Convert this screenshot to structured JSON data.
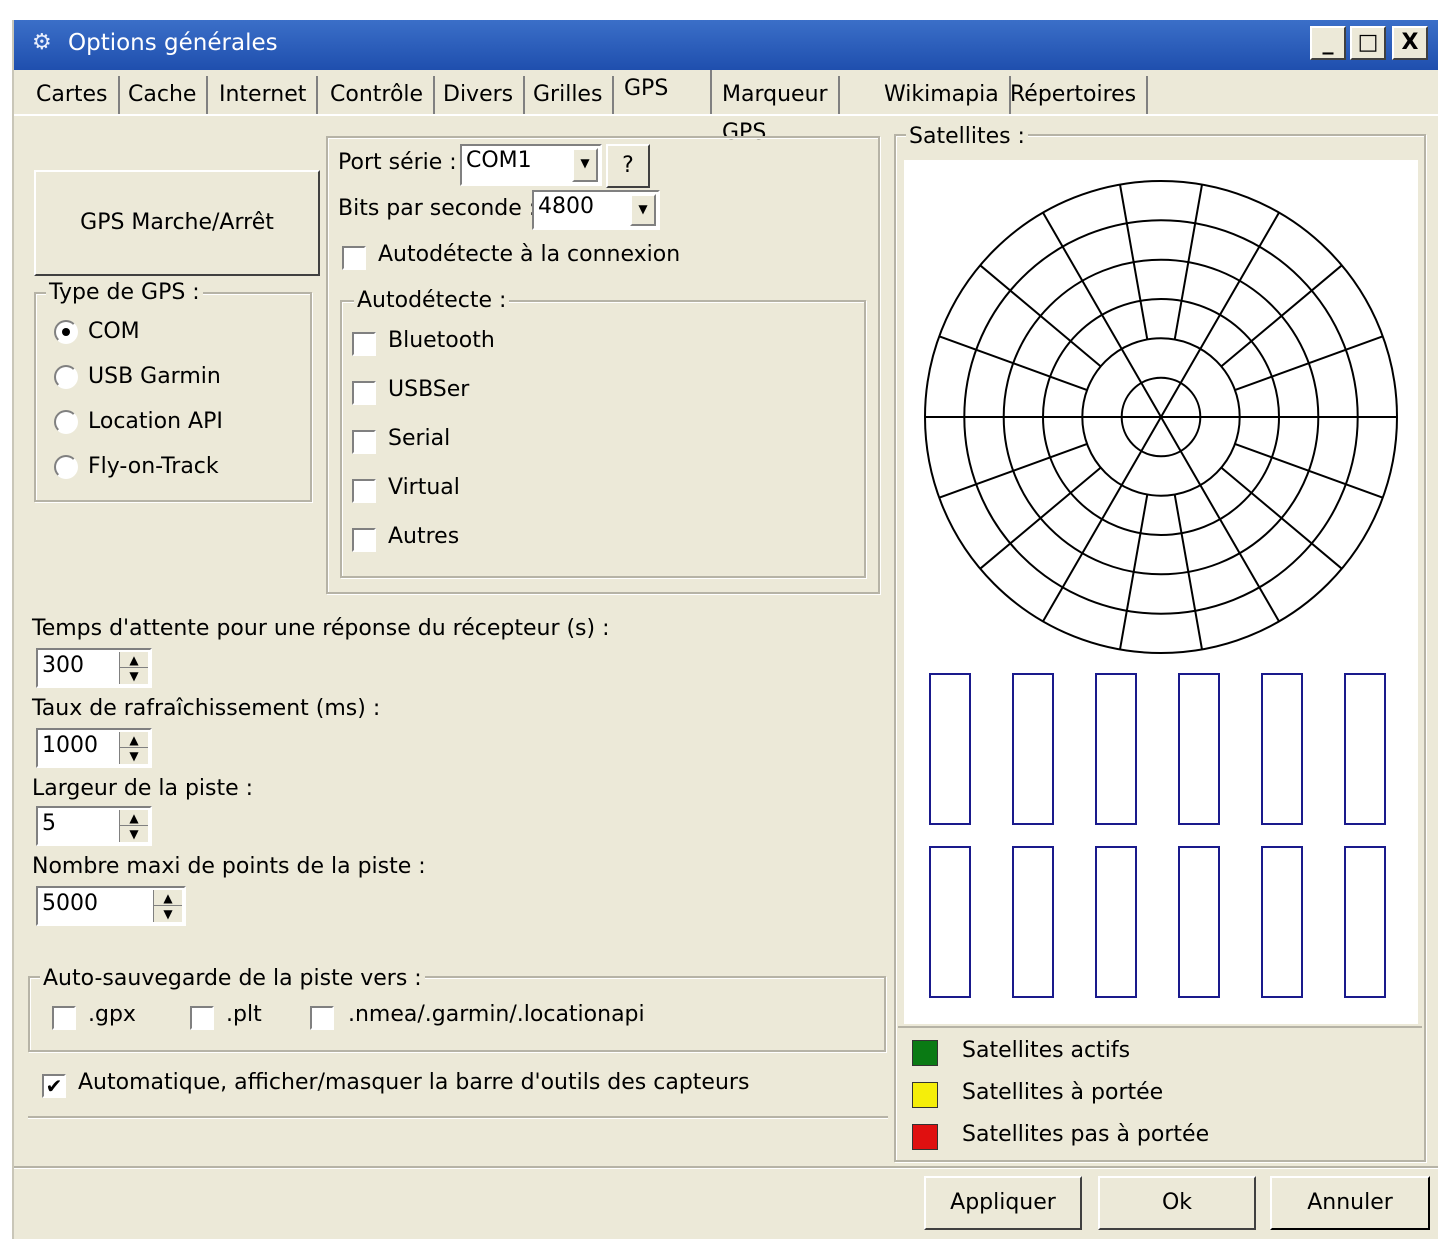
{
  "window": {
    "title": "Options générales",
    "icon": "gear-icon",
    "controls": {
      "minimize": "_",
      "maximize": "□",
      "close": "X"
    }
  },
  "tabs": [
    {
      "label": "Cartes",
      "active": false
    },
    {
      "label": "Cache",
      "active": false
    },
    {
      "label": "Internet",
      "active": false
    },
    {
      "label": "Contrôle",
      "active": false
    },
    {
      "label": "Divers",
      "active": false
    },
    {
      "label": "Grilles",
      "active": false
    },
    {
      "label": "GPS",
      "active": true
    },
    {
      "label": "Marqueur GPS",
      "active": false
    },
    {
      "label": "Wikimapia",
      "active": false
    },
    {
      "label": "Répertoires",
      "active": false
    }
  ],
  "gps_toggle_label": "GPS Marche/Arrêt",
  "gps_type": {
    "legend": "Type de GPS :",
    "options": [
      {
        "label": "COM",
        "selected": true
      },
      {
        "label": "USB Garmin",
        "selected": false
      },
      {
        "label": "Location API",
        "selected": false
      },
      {
        "label": "Fly-on-Track",
        "selected": false
      }
    ]
  },
  "serial": {
    "port_label": "Port série :",
    "port_value": "COM1",
    "help_label": "?",
    "baud_label": "Bits par seconde :",
    "baud_value": "4800",
    "autodetect_on_connect": {
      "label": "Autodétecte à la connexion",
      "checked": false
    }
  },
  "autodetect": {
    "legend": "Autodétecte :",
    "items": [
      {
        "label": "Bluetooth",
        "checked": false
      },
      {
        "label": "USBSer",
        "checked": false
      },
      {
        "label": "Serial",
        "checked": false
      },
      {
        "label": "Virtual",
        "checked": false
      },
      {
        "label": "Autres",
        "checked": false
      }
    ]
  },
  "settings": [
    {
      "label": "Temps d'attente pour une réponse du récepteur (s) :",
      "value": "300"
    },
    {
      "label": "Taux de rafraîchissement (ms) :",
      "value": "1000"
    },
    {
      "label": "Largeur de la piste :",
      "value": "5"
    },
    {
      "label": "Nombre maxi de points de la piste :",
      "value": "5000"
    }
  ],
  "autosave": {
    "legend": "Auto-sauvegarde de la piste vers :",
    "options": [
      {
        "label": ".gpx",
        "checked": false
      },
      {
        "label": ".plt",
        "checked": false
      },
      {
        "label": ".nmea/.garmin/.locationapi",
        "checked": false
      }
    ]
  },
  "sensor_toolbar": {
    "label": "Automatique, afficher/masquer la barre d'outils des capteurs",
    "checked": true
  },
  "satellites": {
    "legend": "Satellites :",
    "rings": 6,
    "spokes": 18,
    "signal_bars": 12,
    "bar_color": "#1a1a8c",
    "legend_items": [
      {
        "label": "Satellites actifs",
        "color": "#0a7a14"
      },
      {
        "label": "Satellites à portée",
        "color": "#f5ee0a"
      },
      {
        "label": "Satellites pas à portée",
        "color": "#e01010"
      }
    ]
  },
  "buttons": {
    "apply": "Appliquer",
    "ok": "Ok",
    "cancel": "Annuler"
  }
}
